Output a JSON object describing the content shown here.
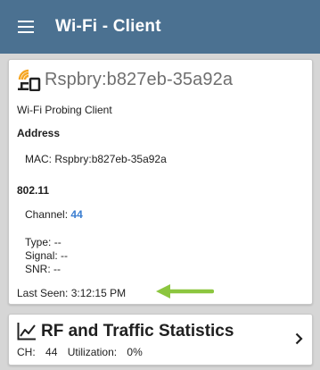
{
  "appbar": {
    "title": "Wi-Fi - Client"
  },
  "device": {
    "name": "Rspbry:b827eb-35a92a",
    "type": "Wi-Fi Probing Client",
    "address_heading": "Address",
    "mac_label": "MAC:",
    "mac_value": "Rspbry:b827eb-35a92a",
    "section_80211": "802.11",
    "channel_label": "Channel:",
    "channel_value": "44",
    "type_label": "Type:",
    "type_value": "--",
    "signal_label": "Signal:",
    "signal_value": "--",
    "snr_label": "SNR:",
    "snr_value": "--",
    "last_seen_label": "Last Seen:",
    "last_seen_value": "3:12:15 PM"
  },
  "stats": {
    "title": "RF and Traffic Statistics",
    "ch_label": "CH:",
    "ch_value": "44",
    "util_label": "Utilization:",
    "util_value": "0%"
  },
  "colors": {
    "appbar": "#4b7191",
    "channel_accent": "#3a7dd0",
    "arrow": "#8cc63f",
    "wifi_icon": "#f5a623"
  },
  "icons": [
    "menu-icon",
    "wifi-client-icon",
    "pointer-arrow-icon",
    "line-chart-icon",
    "chevron-right-icon"
  ]
}
